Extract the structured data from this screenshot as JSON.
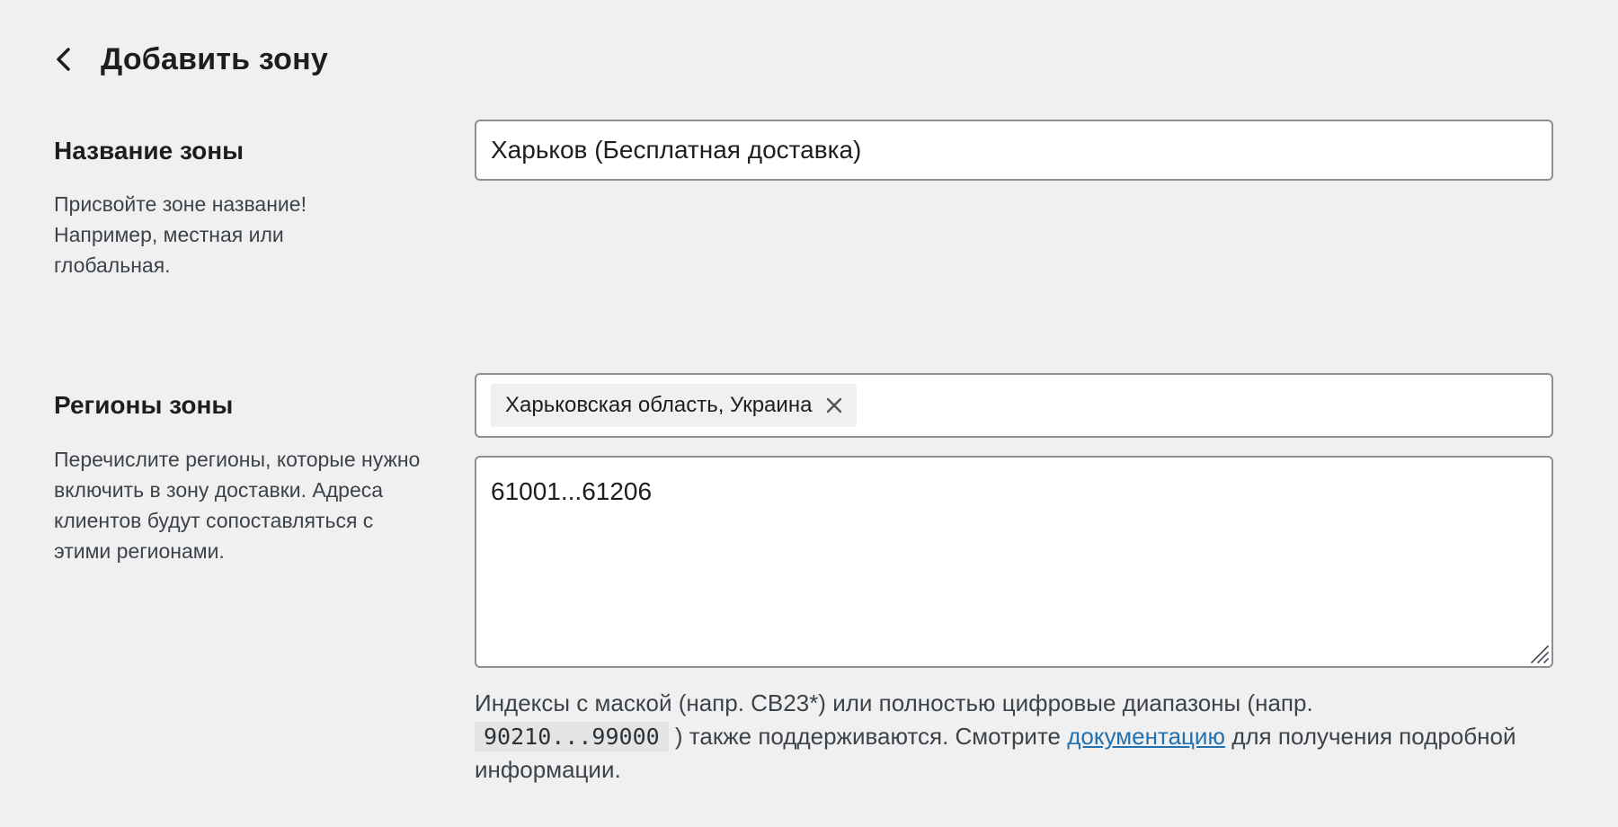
{
  "header": {
    "title": "Добавить зону",
    "back_icon": "chevron-left-icon"
  },
  "zone_name": {
    "title": "Название зоны",
    "description": "Присвойте зоне название! Например, местная или глобальная.",
    "value": "Харьков (Бесплатная доставка)"
  },
  "zone_regions": {
    "title": "Регионы зоны",
    "description": "Перечислите регионы, которые нужно включить в зону доставки. Адреса клиентов будут сопоставляться с этими регионами.",
    "selected": [
      {
        "label": "Харьковская область, Украина",
        "remove_icon": "close-icon"
      }
    ],
    "postcodes": "61001...61206",
    "help": {
      "part1": "Индексы с маской (напр. CB23*) или полностью цифровые диапазоны (напр.",
      "code": "90210...99000",
      "part2": ") также поддерживаются. Смотрите",
      "link_text": "документацию",
      "part3": "для получения подробной информации."
    }
  },
  "colors": {
    "background": "#f0f0f1",
    "link": "#2271b1",
    "border": "#8c8f94"
  }
}
